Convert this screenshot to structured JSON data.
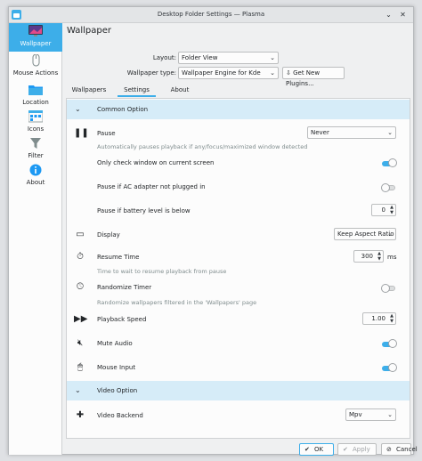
{
  "window": {
    "title": "Desktop Folder Settings — Plasma"
  },
  "sidebar": {
    "items": [
      {
        "label": "Wallpaper"
      },
      {
        "label": "Mouse Actions"
      },
      {
        "label": "Location"
      },
      {
        "label": "Icons"
      },
      {
        "label": "Filter"
      },
      {
        "label": "About"
      }
    ]
  },
  "page": {
    "title": "Wallpaper",
    "layout_label": "Layout:",
    "layout_value": "Folder View",
    "wallpaper_type_label": "Wallpaper type:",
    "wallpaper_type_value": "Wallpaper Engine for Kde",
    "get_plugins_label": "Get New Plugins..."
  },
  "tabs": [
    {
      "label": "Wallpapers"
    },
    {
      "label": "Settings"
    },
    {
      "label": "About"
    }
  ],
  "settings": {
    "common_section": "Common Option",
    "pause_label": "Pause",
    "pause_value": "Never",
    "pause_hint": "Automatically pauses playback if any/focus/maximized window detected",
    "only_check_label": "Only check window on current screen",
    "pause_ac_label": "Pause if AC adapter not plugged in",
    "pause_battery_label": "Pause if battery level is below",
    "pause_battery_value": "0",
    "display_label": "Display",
    "display_value": "Keep Aspect Ratio",
    "resume_time_label": "Resume Time",
    "resume_time_value": "300",
    "resume_time_unit": "ms",
    "resume_hint": "Time to wait to resume playback from pause",
    "randomize_label": "Randomize Timer",
    "randomize_hint": "Randomize wallpapers filtered in the 'Wallpapers' page",
    "playback_speed_label": "Playback Speed",
    "playback_speed_value": "1.00",
    "mute_label": "Mute Audio",
    "mouse_input_label": "Mouse Input",
    "video_section": "Video Option",
    "video_backend_label": "Video Backend",
    "video_backend_value": "Mpv"
  },
  "footer": {
    "ok_label": "OK",
    "apply_label": "Apply",
    "cancel_label": "Cancel"
  },
  "colors": {
    "accent": "#3daee9",
    "section_bg": "#d6ecf8"
  }
}
